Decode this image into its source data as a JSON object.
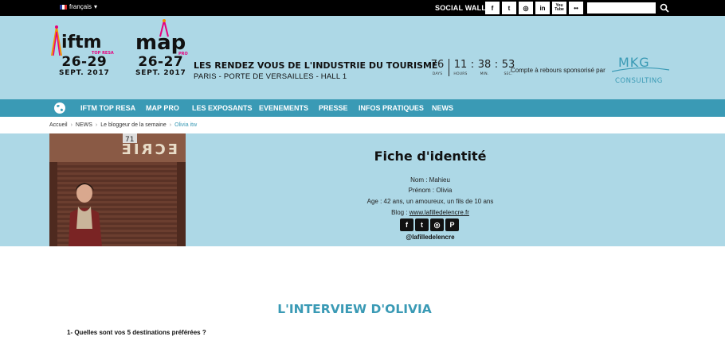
{
  "topbar": {
    "language": "français",
    "social_label": "SOCIAL WALL",
    "social_icons": [
      {
        "name": "facebook-icon",
        "glyph": "f"
      },
      {
        "name": "twitter-icon",
        "glyph": "t"
      },
      {
        "name": "instagram-icon",
        "glyph": "◎"
      },
      {
        "name": "linkedin-icon",
        "glyph": "in"
      },
      {
        "name": "youtube-icon",
        "glyph": "You Tube"
      },
      {
        "name": "flickr-icon",
        "glyph": "••"
      }
    ],
    "search_placeholder": ""
  },
  "header": {
    "logo_iftm": {
      "text": "iftm",
      "sub": "TOP RESA"
    },
    "logo_map": {
      "text": "map",
      "sub": "PRO"
    },
    "date_iftm": {
      "days": "26-29",
      "month": "SEPT. 2017"
    },
    "date_map": {
      "days": "26-27",
      "month": "SEPT. 2017"
    },
    "tagline": "LES RENDEZ VOUS DE L'INDUSTRIE DU TOURISME",
    "location": "PARIS - PORTE DE VERSAILLES - HALL 1",
    "countdown": {
      "days": "76",
      "hours": "11",
      "minutes": "38",
      "seconds": "53",
      "days_label": "DAYS",
      "hours_label": "HOURS",
      "minutes_label": "MIN.",
      "seconds_label": "SEC."
    },
    "sponsor_text": "Compte à rebours sponsorisé par",
    "sponsor_logo": {
      "top": "MKG",
      "bottom": "CONSULTING"
    }
  },
  "nav": {
    "items": [
      "IFTM TOP RESA",
      "MAP PRO",
      "LES EXPOSANTS",
      "EVENEMENTS",
      "PRESSE",
      "INFOS PRATIQUES",
      "NEWS"
    ]
  },
  "breadcrumb": [
    "Accueil",
    "NEWS",
    "Le bloggeur de la semaine",
    "Olivia itw"
  ],
  "identity": {
    "title": "Fiche d'identité",
    "nom": "Nom : Mahieu",
    "prenom": "Prénom : Olivia",
    "age": "Age : 42 ans, un amoureux, un fils de 10 ans",
    "blog_label": "Blog : ",
    "blog_link": "www.lafilledelencre.fr",
    "handle": "@lafilledelencre",
    "photo_sign": "71",
    "photo_shop_text": "ECRIE"
  },
  "article": {
    "title": "L'INTERVIEW D'OLIVIA",
    "question_1": "1- Quelles sont vos 5 destinations préférées ?"
  },
  "colors": {
    "header_bg": "#add8e6",
    "nav_bg": "#3a9ab5",
    "accent_pink": "#e6007e",
    "accent_orange": "#f39200"
  }
}
